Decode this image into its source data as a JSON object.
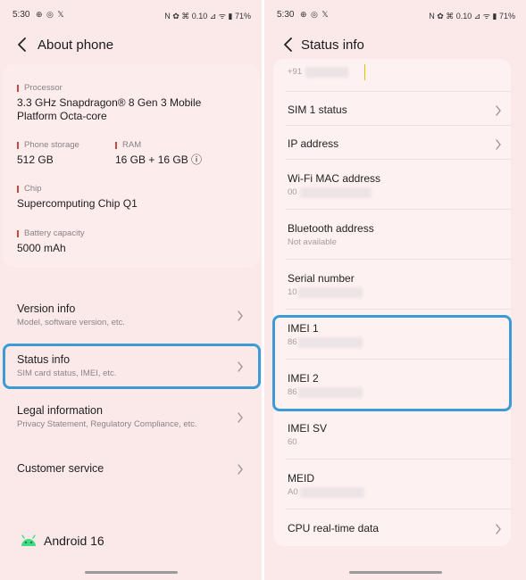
{
  "status_bar": {
    "time": "5:30",
    "left_icons": "⊕ ◎ 𝕏",
    "right_icons": "N ✿ ⌘ 0.10 ⊿ ᯤ ▮ 71%",
    "battery": "71%"
  },
  "about_phone": {
    "title": "About phone",
    "processor_label": "Processor",
    "processor_value": "3.3 GHz Snapdragon® 8 Gen 3 Mobile Platform Octa-core",
    "storage_label": "Phone storage",
    "storage_value": "512 GB",
    "ram_label": "RAM",
    "ram_value": "16 GB + 16 GB ⓘ",
    "chip_label": "Chip",
    "chip_value": "Supercomputing Chip Q1",
    "battery_label": "Battery capacity",
    "battery_value": "5000 mAh",
    "items": [
      {
        "title": "Version info",
        "subtitle": "Model, software version, etc."
      },
      {
        "title": "Status info",
        "subtitle": "SIM card status, IMEI, etc."
      },
      {
        "title": "Legal information",
        "subtitle": "Privacy Statement, Regulatory Compliance, etc."
      },
      {
        "title": "Customer service",
        "subtitle": ""
      }
    ],
    "android_version": "Android 16"
  },
  "status_info": {
    "title": "Status info",
    "phone_number_partial": "+91",
    "items": [
      {
        "title": "SIM 1 status",
        "value": ""
      },
      {
        "title": "IP address",
        "value": ""
      },
      {
        "title": "Wi-Fi MAC address",
        "value": "00"
      },
      {
        "title": "Bluetooth address",
        "value": "Not available"
      },
      {
        "title": "Serial number",
        "value": "10"
      },
      {
        "title": "IMEI 1",
        "value": "86"
      },
      {
        "title": "IMEI 2",
        "value": "86"
      },
      {
        "title": "IMEI SV",
        "value": "60"
      },
      {
        "title": "MEID",
        "value": "A0"
      },
      {
        "title": "CPU real-time data",
        "value": ""
      }
    ]
  },
  "colors": {
    "screen_bg": "#fbe9ea",
    "accent_bar": "#c9483e",
    "highlight": "#3c9ad6",
    "android_green": "#3ddc84"
  }
}
